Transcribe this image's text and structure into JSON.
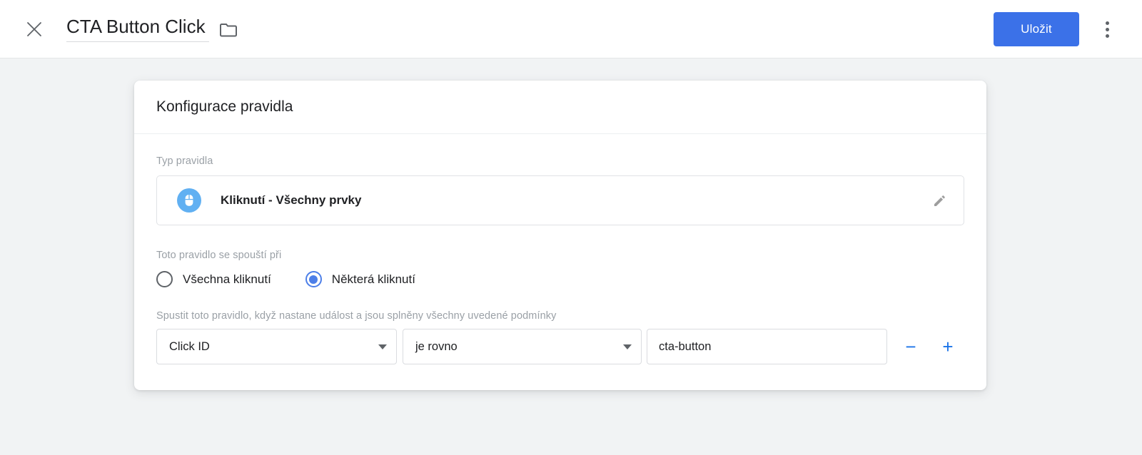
{
  "header": {
    "close_icon": "close-icon",
    "title_value": "CTA Button Click",
    "folder_icon": "folder-icon",
    "save_label": "Uložit",
    "more_icon": "more-vertical-icon",
    "save_color": "#3b71e8"
  },
  "card": {
    "title": "Konfigurace pravidla",
    "trigger_type": {
      "label": "Typ pravidla",
      "icon": "mouse-click-icon",
      "icon_color": "#61b0f2",
      "name": "Kliknutí - Všechny prvky",
      "edit_icon": "pencil-icon"
    },
    "fires_on": {
      "label": "Toto pravidlo se spouští při",
      "options": [
        {
          "label": "Všechna kliknutí",
          "selected": false
        },
        {
          "label": "Některá kliknutí",
          "selected": true
        }
      ],
      "selected_color": "#4d7fe8"
    },
    "conditions": {
      "label": "Spustit toto pravidlo, když nastane událost a jsou splněny všechny uvedené podmínky",
      "rows": [
        {
          "variable": "Click ID",
          "operator": "je rovno",
          "value": "cta-button",
          "value_placeholder": "",
          "remove_label": "−",
          "add_label": "+"
        }
      ],
      "action_color": "#1a73e8"
    }
  }
}
